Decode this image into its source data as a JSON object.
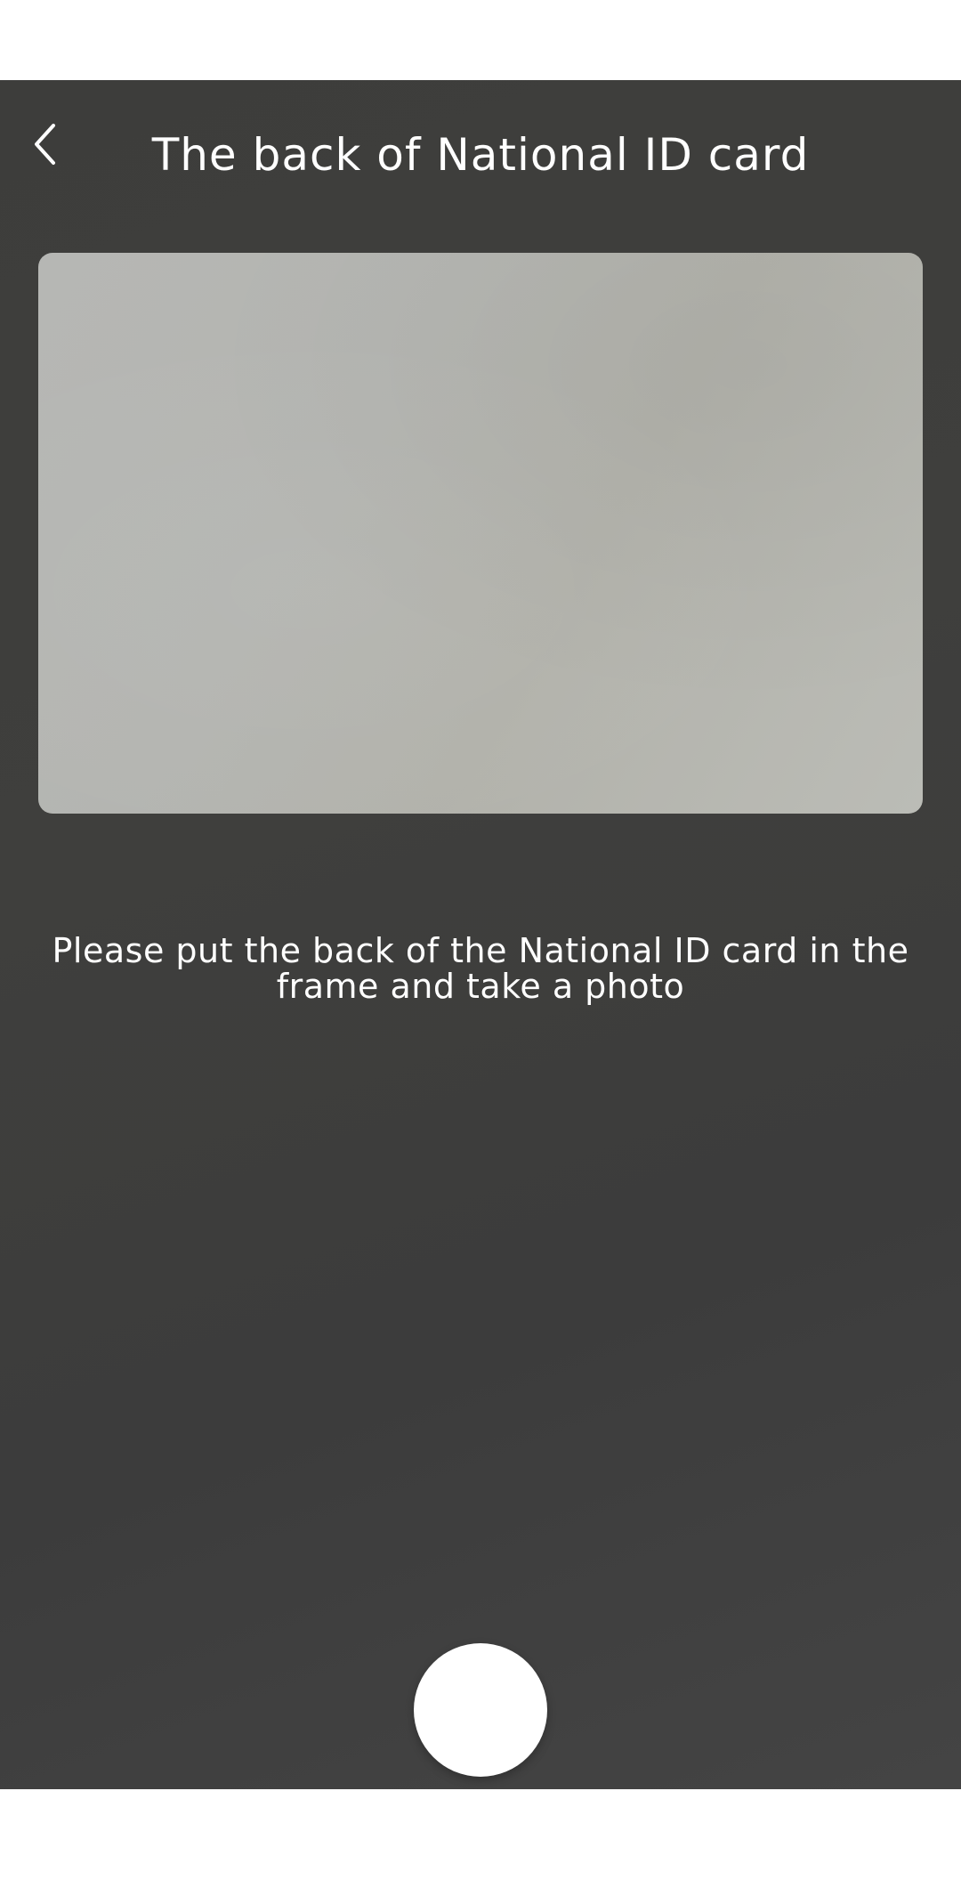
{
  "header": {
    "title": "The back of National ID card",
    "back_icon": "chevron-left-icon"
  },
  "main": {
    "instruction": "Please put the back of the National ID card in the frame and take a photo"
  },
  "controls": {
    "shutter_icon": "shutter-button"
  },
  "colors": {
    "background": "#3e3e3c",
    "card_frame": "#b5b6b1",
    "text": "#ffffff",
    "shutter": "#ffffff"
  }
}
